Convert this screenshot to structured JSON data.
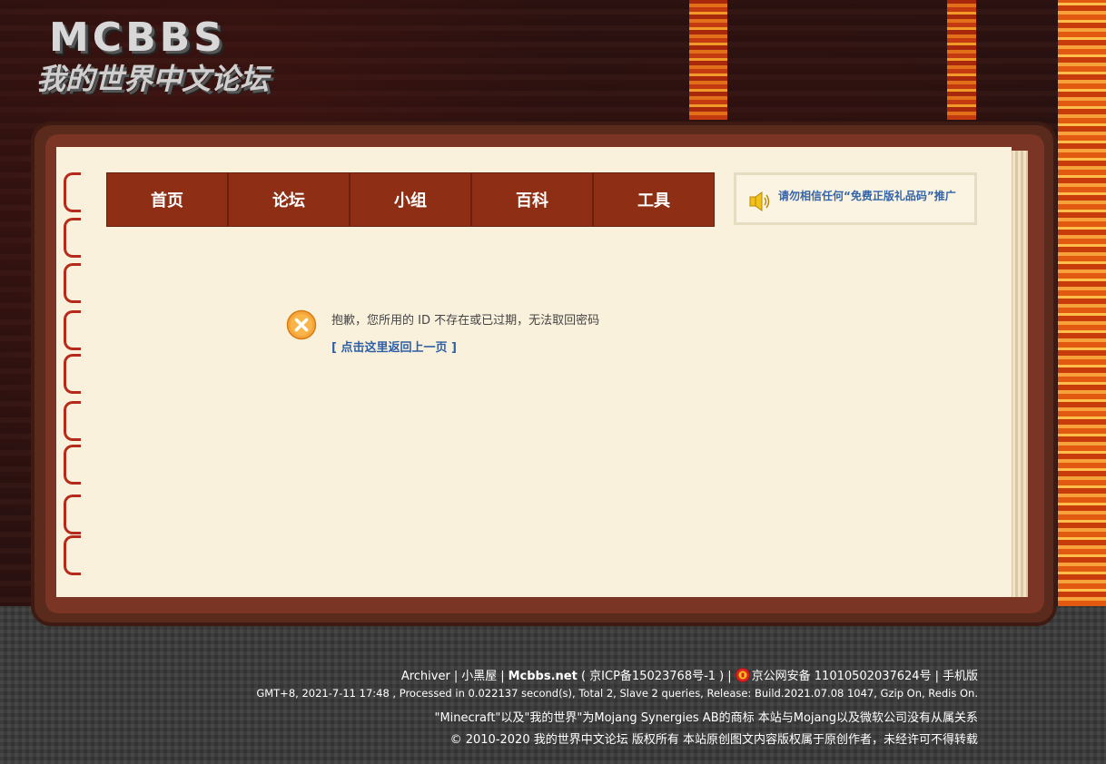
{
  "logo": {
    "letters": "MCBBS",
    "subtitle": "我的世界中文论坛"
  },
  "nav": {
    "items": [
      {
        "label": "首页"
      },
      {
        "label": "论坛"
      },
      {
        "label": "小组"
      },
      {
        "label": "百科"
      },
      {
        "label": "工具"
      }
    ]
  },
  "notice": {
    "icon": "speaker-icon",
    "text": "请勿相信任何“免费正版礼品码”推广"
  },
  "message": {
    "icon": "error-x-icon",
    "text": "抱歉，您所用的 ID 不存在或已过期，无法取回密码",
    "back_link": "[ 点击这里返回上一页 ]"
  },
  "footer": {
    "line1": {
      "archiver": "Archiver",
      "sep": "|",
      "blackroom": "小黑屋",
      "site": "Mcbbs.net",
      "icp": "( 京ICP备15023768号-1 )",
      "police": "京公网安备 11010502037624号",
      "mobile": "手机版"
    },
    "line2": "GMT+8, 2021-7-11 17:48 , Processed in 0.022137 second(s), Total 2, Slave 2 queries, Release: Build.2021.07.08 1047, Gzip On, Redis On.",
    "line3": "\"Minecraft\"以及\"我的世界\"为Mojang Synergies AB的商标 本站与Mojang以及微软公司没有从属关系",
    "line4": "© 2010-2020 我的世界中文论坛 版权所有 本站原创图文内容版权属于原创作者，未经许可不得转载"
  },
  "colors": {
    "nav_bg": "#8e2e14",
    "page_bg": "#faf1dc",
    "link": "#2d5fa6",
    "footer_bg": "#3a3a3a"
  }
}
